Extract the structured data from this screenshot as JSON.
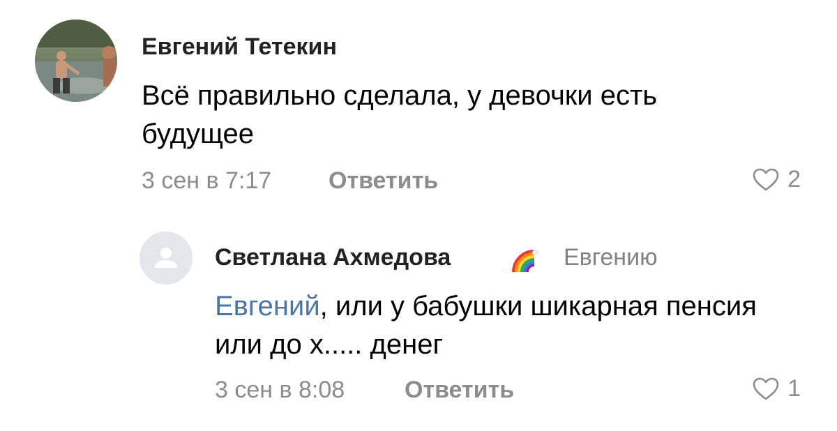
{
  "comments": [
    {
      "author": "Евгений Тетекин",
      "text": "Всё правильно сделала, у девочки есть будущее",
      "time": "3 сен в 7:17",
      "reply_label": "Ответить",
      "likes": "2"
    },
    {
      "author": "Светлана Ахмедова",
      "reply_to": "Евгению",
      "mention": "Евгений",
      "text": ", или у бабушки шикарная пенсия или до х..... денег",
      "time": "3 сен в 8:08",
      "reply_label": "Ответить",
      "likes": "1"
    }
  ],
  "colors": {
    "link": "#4a76a8",
    "secondary_text": "#8c8c8c",
    "placeholder_avatar": "#e3e7ec"
  },
  "icons": {
    "like": "heart-outline-icon",
    "badge": "rainbow-emoji",
    "empty_avatar": "user-placeholder-icon"
  }
}
